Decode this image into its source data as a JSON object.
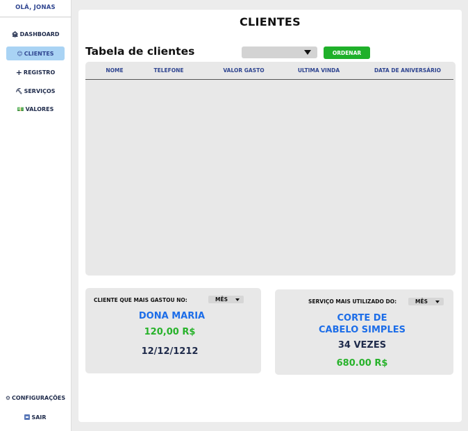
{
  "sidebar": {
    "greeting": "OLÁ, JONAS",
    "items": [
      {
        "icon": "house-person-icon",
        "glyph": "🏚",
        "label": "DASHBOARD"
      },
      {
        "icon": "smiley-icon",
        "glyph": "😊",
        "label": "CLIENTES"
      },
      {
        "icon": "plus-icon",
        "glyph": "+",
        "label": "REGISTRO"
      },
      {
        "icon": "tools-icon",
        "glyph": "⛏",
        "label": "SERVIÇOS"
      },
      {
        "icon": "money-icon",
        "glyph": "💵",
        "label": "VALORES"
      }
    ],
    "active_item": "CLIENTES",
    "settings": {
      "icon": "gear-icon",
      "glyph": "⚙",
      "label": "CONFIGURAÇÕES"
    },
    "exit": {
      "icon": "exit-icon",
      "label": "SAIR"
    }
  },
  "main": {
    "title": "CLIENTES",
    "table_title": "Tabela de clientes",
    "sort_select": {
      "value": ""
    },
    "order_button": "ORDENAR",
    "table": {
      "columns": [
        "NOME",
        "TELEFONE",
        "VALOR GASTO",
        "ULTIMA VINDA",
        "DATA DE ANIVERSÁRIO"
      ],
      "rows": []
    }
  },
  "top_client_card": {
    "label": "CLIENTE QUE MAIS GASTOU NO:",
    "period": "MÊS",
    "name": "DONA MARIA",
    "amount": "120,00 R$",
    "date": "12/12/1212"
  },
  "top_service_card": {
    "label": "SERVIÇO MAIS UTILIZADO DO:",
    "period": "MÊS",
    "service_line1": "CORTE DE",
    "service_line2": "CABELO SIMPLES",
    "count": "34 VEZES",
    "amount": "680.00 R$"
  },
  "colors": {
    "active_nav": "#a9d3f4",
    "accent_blue": "#1c6de8",
    "accent_green": "#27b22a",
    "button_green": "#1fb02a",
    "text_dark_blue": "#2f4590"
  }
}
